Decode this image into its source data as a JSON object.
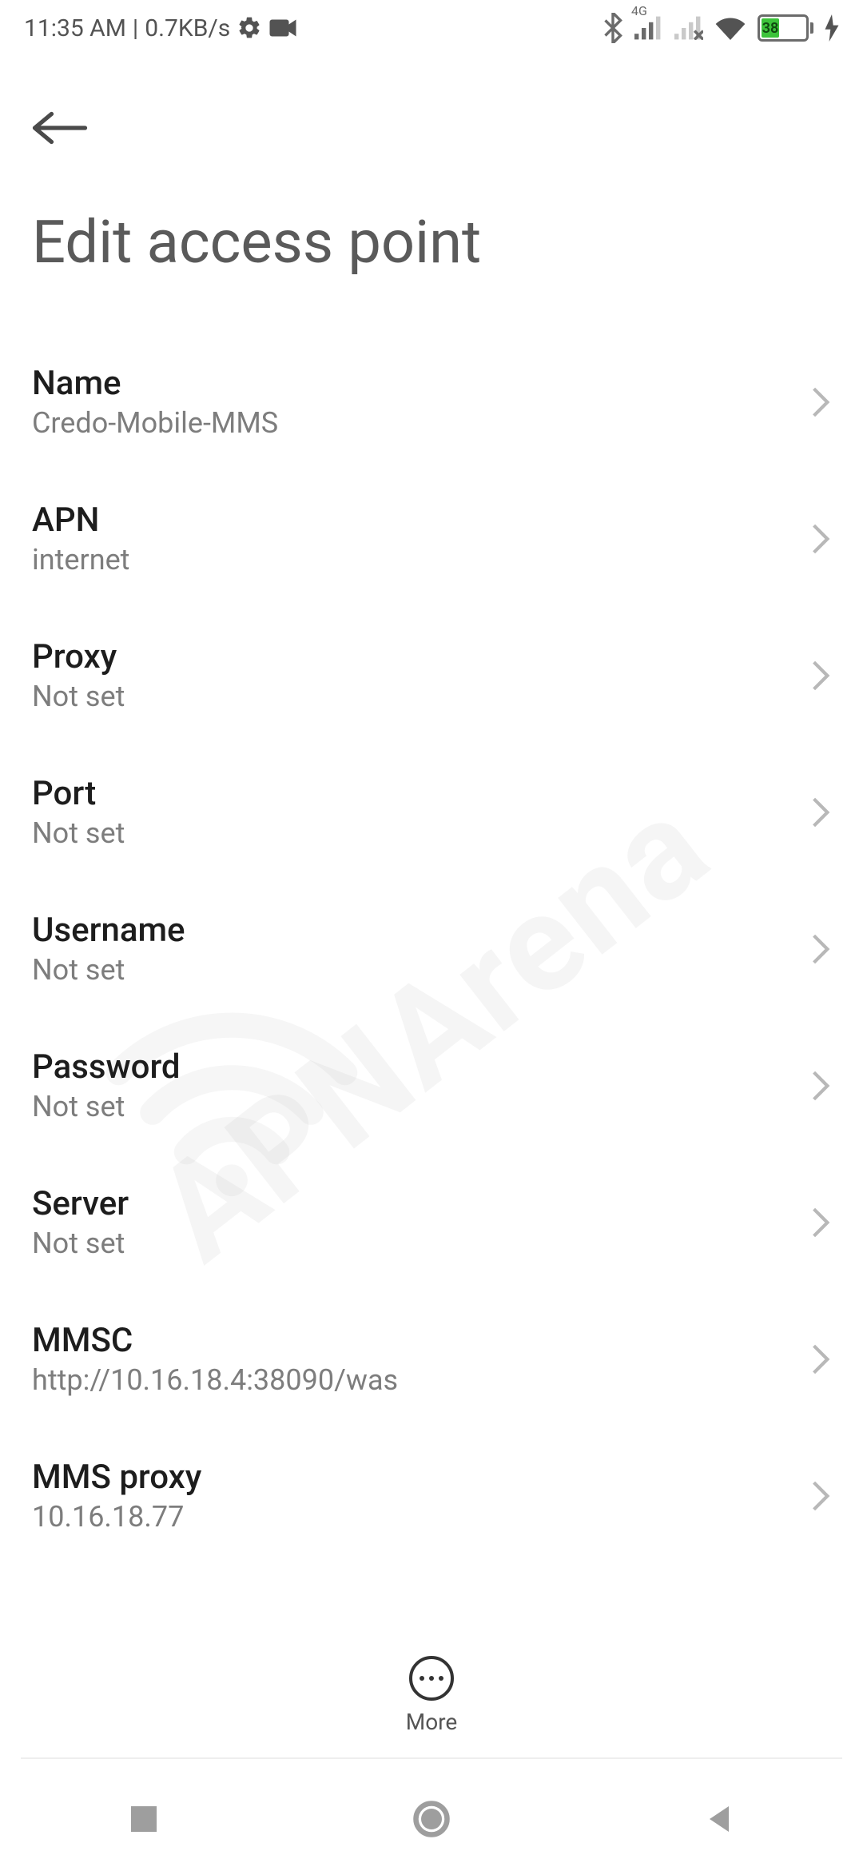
{
  "statusbar": {
    "time": "11:35 AM",
    "speed": "0.7KB/s",
    "network_tag": "4G",
    "battery_text": "38"
  },
  "header": {
    "title": "Edit access point"
  },
  "rows": [
    {
      "label": "Name",
      "value": "Credo-Mobile-MMS"
    },
    {
      "label": "APN",
      "value": "internet"
    },
    {
      "label": "Proxy",
      "value": "Not set"
    },
    {
      "label": "Port",
      "value": "Not set"
    },
    {
      "label": "Username",
      "value": "Not set"
    },
    {
      "label": "Password",
      "value": "Not set"
    },
    {
      "label": "Server",
      "value": "Not set"
    },
    {
      "label": "MMSC",
      "value": "http://10.16.18.4:38090/was"
    },
    {
      "label": "MMS proxy",
      "value": "10.16.18.77"
    }
  ],
  "bottom": {
    "more_label": "More"
  },
  "watermark": {
    "text": "APNArena"
  }
}
